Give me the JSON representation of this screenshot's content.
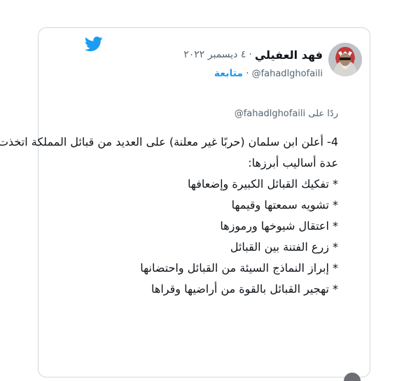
{
  "tweet": {
    "display_name": "فهد العفيلي",
    "separator": "·",
    "date": "٤ ديسمبر ٢٠٢٢",
    "handle": "@fahadlghofaili",
    "follow_label": "متابعة",
    "reply_prefix": "ردًا على",
    "reply_mention": "@fahadlghofaili",
    "body_lines": [
      "4- أعلن ابن سلمان (حربًا غير معلنة) على العديد من قبائل المملكة اتخذت",
      "عدة أساليب أبرزها:",
      "* تفكيك القبائل الكبيرة وإضعافها",
      "* تشويه سمعتها وقيمها",
      "* اعتقال شيوخها ورموزها",
      "* زرع الفتنة بين القبائل",
      "* إبراز النماذج السيئة من القبائل واحتضانها",
      "* تهجير القبائل بالقوة من أراضيها وقراها"
    ]
  },
  "icons": {
    "brand": "twitter-bird-icon",
    "brand_color": "#1d9bf0"
  },
  "colors": {
    "text": "#0f1419",
    "muted": "#536471",
    "link": "#1d9bf0",
    "border": "#cfd9de"
  }
}
